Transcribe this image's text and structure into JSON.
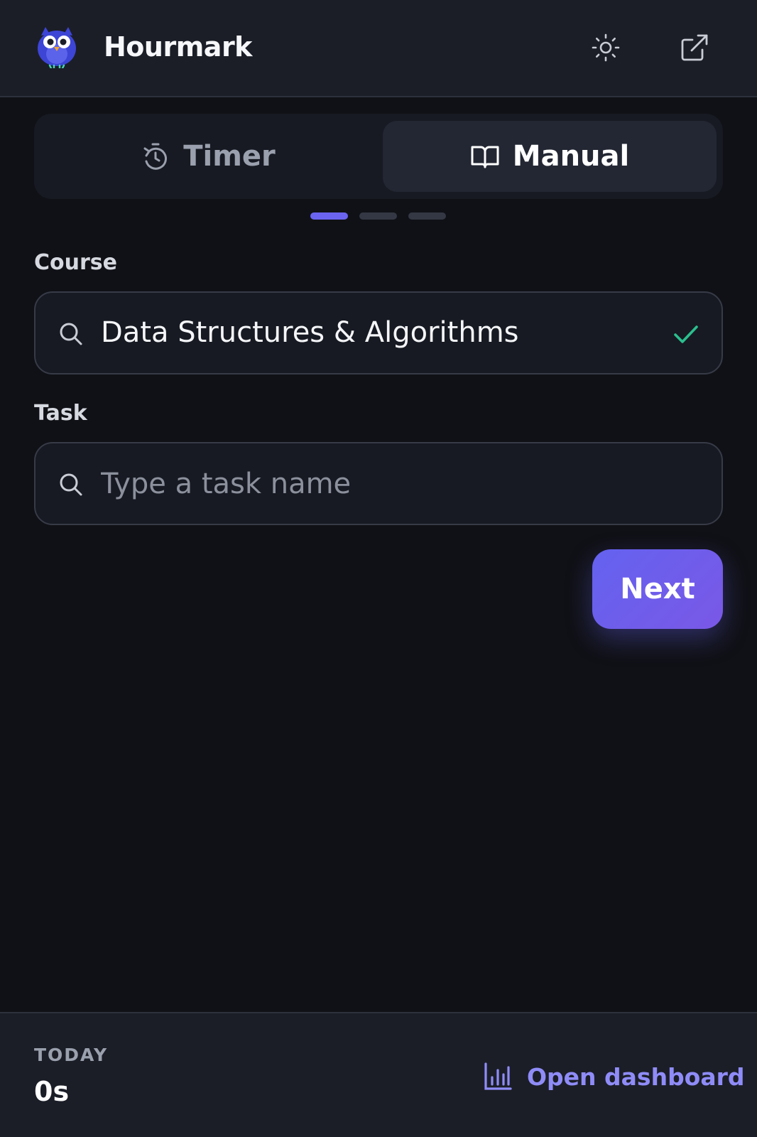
{
  "header": {
    "app_name": "Hourmark",
    "logo_icon": "owl-logo-icon",
    "theme_icon": "sun-icon",
    "external_icon": "external-link-icon"
  },
  "tabs": [
    {
      "label": "Timer",
      "icon": "timer-icon",
      "active": false
    },
    {
      "label": "Manual",
      "icon": "book-open-icon",
      "active": true
    }
  ],
  "steps": {
    "total": 3,
    "current": 1
  },
  "course": {
    "label": "Course",
    "value": "Data Structures & Algorithms",
    "valid": true
  },
  "task": {
    "label": "Task",
    "value": "",
    "placeholder": "Type a task name"
  },
  "next_label": "Next",
  "footer": {
    "today_label": "TODAY",
    "today_value": "0s",
    "dashboard_label": "Open dashboard",
    "dashboard_icon": "bar-chart-icon"
  },
  "colors": {
    "accent": "#6a64f0",
    "link": "#8f8cf8",
    "success": "#2bbf8e",
    "background": "#101116",
    "panel": "#1b1e27"
  }
}
